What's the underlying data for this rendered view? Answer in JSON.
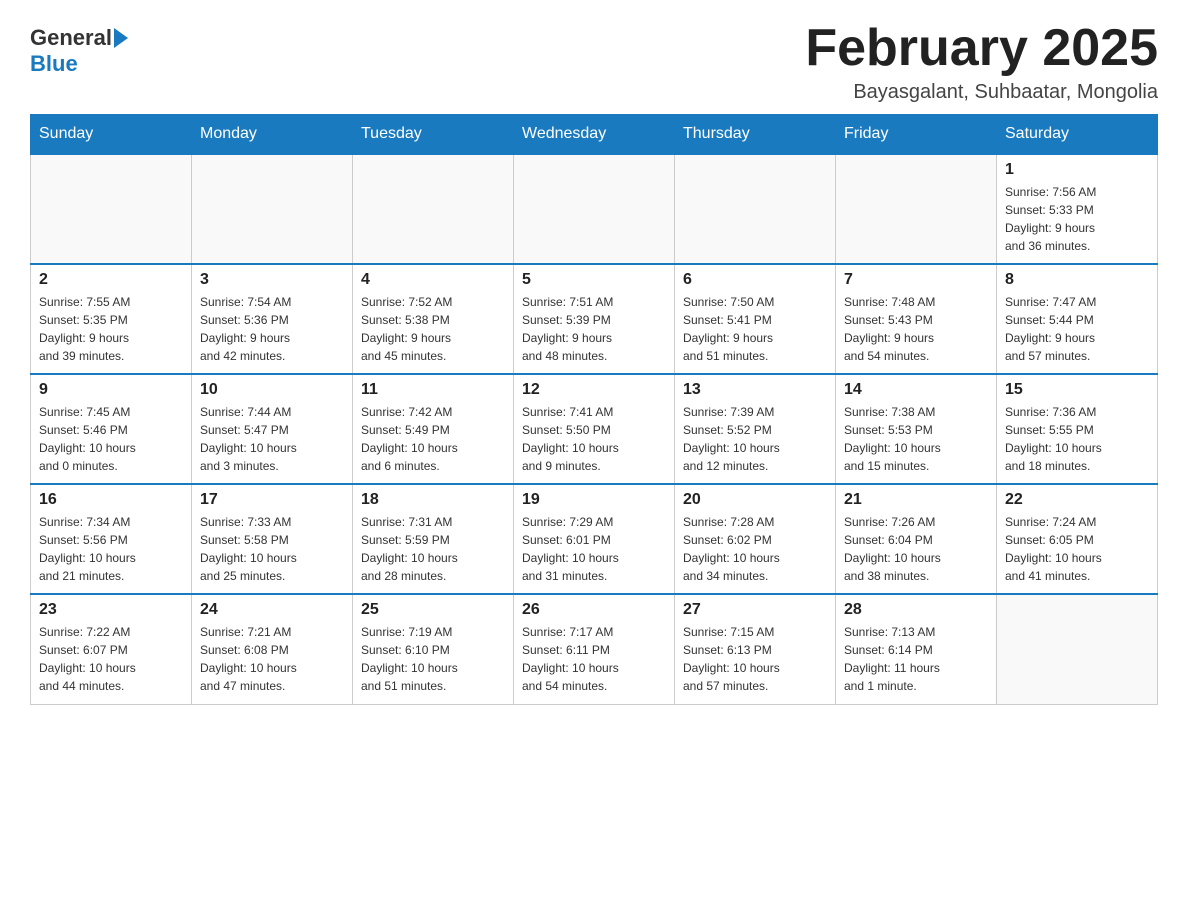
{
  "header": {
    "logo": {
      "general": "General",
      "blue": "Blue"
    },
    "title": "February 2025",
    "location": "Bayasgalant, Suhbaatar, Mongolia"
  },
  "weekdays": [
    "Sunday",
    "Monday",
    "Tuesday",
    "Wednesday",
    "Thursday",
    "Friday",
    "Saturday"
  ],
  "weeks": [
    [
      {
        "day": "",
        "info": ""
      },
      {
        "day": "",
        "info": ""
      },
      {
        "day": "",
        "info": ""
      },
      {
        "day": "",
        "info": ""
      },
      {
        "day": "",
        "info": ""
      },
      {
        "day": "",
        "info": ""
      },
      {
        "day": "1",
        "info": "Sunrise: 7:56 AM\nSunset: 5:33 PM\nDaylight: 9 hours\nand 36 minutes."
      }
    ],
    [
      {
        "day": "2",
        "info": "Sunrise: 7:55 AM\nSunset: 5:35 PM\nDaylight: 9 hours\nand 39 minutes."
      },
      {
        "day": "3",
        "info": "Sunrise: 7:54 AM\nSunset: 5:36 PM\nDaylight: 9 hours\nand 42 minutes."
      },
      {
        "day": "4",
        "info": "Sunrise: 7:52 AM\nSunset: 5:38 PM\nDaylight: 9 hours\nand 45 minutes."
      },
      {
        "day": "5",
        "info": "Sunrise: 7:51 AM\nSunset: 5:39 PM\nDaylight: 9 hours\nand 48 minutes."
      },
      {
        "day": "6",
        "info": "Sunrise: 7:50 AM\nSunset: 5:41 PM\nDaylight: 9 hours\nand 51 minutes."
      },
      {
        "day": "7",
        "info": "Sunrise: 7:48 AM\nSunset: 5:43 PM\nDaylight: 9 hours\nand 54 minutes."
      },
      {
        "day": "8",
        "info": "Sunrise: 7:47 AM\nSunset: 5:44 PM\nDaylight: 9 hours\nand 57 minutes."
      }
    ],
    [
      {
        "day": "9",
        "info": "Sunrise: 7:45 AM\nSunset: 5:46 PM\nDaylight: 10 hours\nand 0 minutes."
      },
      {
        "day": "10",
        "info": "Sunrise: 7:44 AM\nSunset: 5:47 PM\nDaylight: 10 hours\nand 3 minutes."
      },
      {
        "day": "11",
        "info": "Sunrise: 7:42 AM\nSunset: 5:49 PM\nDaylight: 10 hours\nand 6 minutes."
      },
      {
        "day": "12",
        "info": "Sunrise: 7:41 AM\nSunset: 5:50 PM\nDaylight: 10 hours\nand 9 minutes."
      },
      {
        "day": "13",
        "info": "Sunrise: 7:39 AM\nSunset: 5:52 PM\nDaylight: 10 hours\nand 12 minutes."
      },
      {
        "day": "14",
        "info": "Sunrise: 7:38 AM\nSunset: 5:53 PM\nDaylight: 10 hours\nand 15 minutes."
      },
      {
        "day": "15",
        "info": "Sunrise: 7:36 AM\nSunset: 5:55 PM\nDaylight: 10 hours\nand 18 minutes."
      }
    ],
    [
      {
        "day": "16",
        "info": "Sunrise: 7:34 AM\nSunset: 5:56 PM\nDaylight: 10 hours\nand 21 minutes."
      },
      {
        "day": "17",
        "info": "Sunrise: 7:33 AM\nSunset: 5:58 PM\nDaylight: 10 hours\nand 25 minutes."
      },
      {
        "day": "18",
        "info": "Sunrise: 7:31 AM\nSunset: 5:59 PM\nDaylight: 10 hours\nand 28 minutes."
      },
      {
        "day": "19",
        "info": "Sunrise: 7:29 AM\nSunset: 6:01 PM\nDaylight: 10 hours\nand 31 minutes."
      },
      {
        "day": "20",
        "info": "Sunrise: 7:28 AM\nSunset: 6:02 PM\nDaylight: 10 hours\nand 34 minutes."
      },
      {
        "day": "21",
        "info": "Sunrise: 7:26 AM\nSunset: 6:04 PM\nDaylight: 10 hours\nand 38 minutes."
      },
      {
        "day": "22",
        "info": "Sunrise: 7:24 AM\nSunset: 6:05 PM\nDaylight: 10 hours\nand 41 minutes."
      }
    ],
    [
      {
        "day": "23",
        "info": "Sunrise: 7:22 AM\nSunset: 6:07 PM\nDaylight: 10 hours\nand 44 minutes."
      },
      {
        "day": "24",
        "info": "Sunrise: 7:21 AM\nSunset: 6:08 PM\nDaylight: 10 hours\nand 47 minutes."
      },
      {
        "day": "25",
        "info": "Sunrise: 7:19 AM\nSunset: 6:10 PM\nDaylight: 10 hours\nand 51 minutes."
      },
      {
        "day": "26",
        "info": "Sunrise: 7:17 AM\nSunset: 6:11 PM\nDaylight: 10 hours\nand 54 minutes."
      },
      {
        "day": "27",
        "info": "Sunrise: 7:15 AM\nSunset: 6:13 PM\nDaylight: 10 hours\nand 57 minutes."
      },
      {
        "day": "28",
        "info": "Sunrise: 7:13 AM\nSunset: 6:14 PM\nDaylight: 11 hours\nand 1 minute."
      },
      {
        "day": "",
        "info": ""
      }
    ]
  ]
}
